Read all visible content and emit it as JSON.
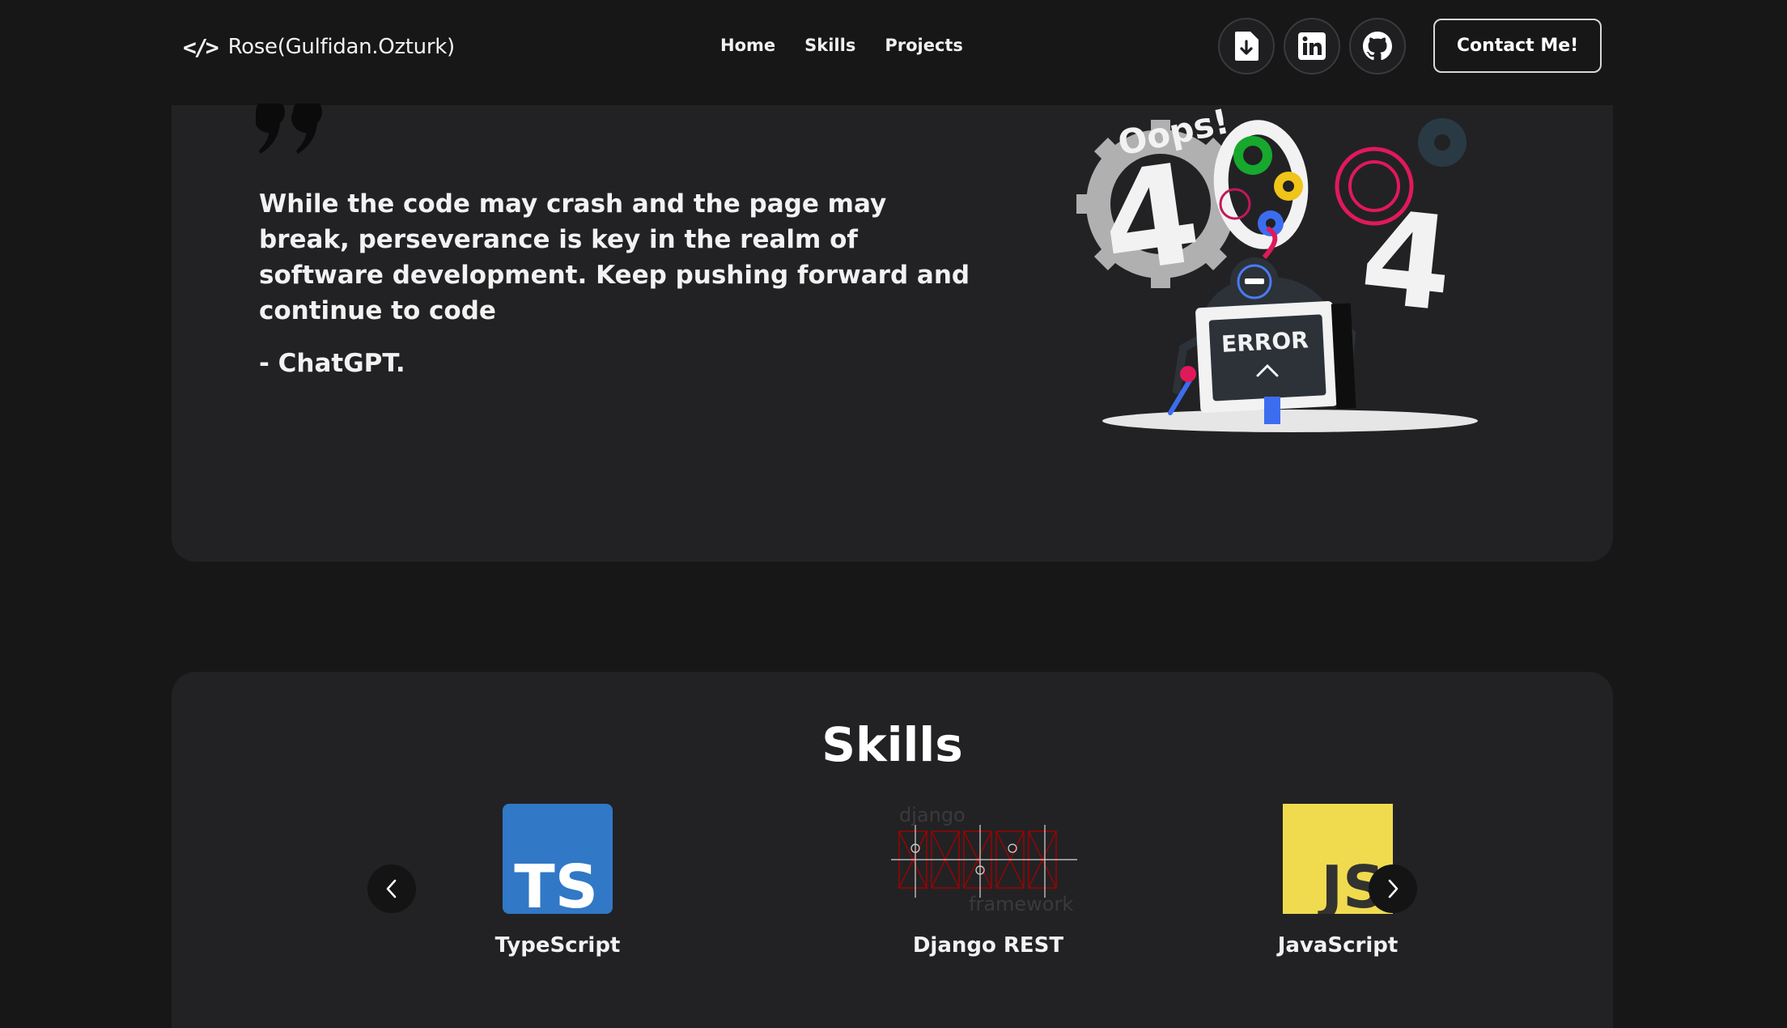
{
  "navbar": {
    "brand": "Rose(Gulfidan.Ozturk)",
    "brand_icon": "code-brackets-icon",
    "links": [
      "Home",
      "Skills",
      "Projects"
    ],
    "social_icons": [
      "download-resume-icon",
      "linkedin-icon",
      "github-icon"
    ],
    "contact_label": "Contact Me!"
  },
  "quote": {
    "text": "While the code may crash and the page may break, perseverance is key in the realm of software development. Keep pushing forward and continue to code",
    "author": "- ChatGPT.",
    "illustration": {
      "oops": "Oops!",
      "digits": [
        "4",
        "0",
        "4"
      ],
      "screen_label": "ERROR"
    }
  },
  "skills": {
    "title": "Skills",
    "items": [
      {
        "label": "TypeScript",
        "logo_text": "TS",
        "color": "#3178c6"
      },
      {
        "label": "Django REST",
        "logo_text_top": "django",
        "logo_text_bottom": "framework",
        "color": "#a30000"
      },
      {
        "label": "JavaScript",
        "logo_text": "JS",
        "color": "#f0db4f"
      }
    ]
  },
  "colors": {
    "background": "#171718",
    "card": "#222224",
    "accent_blue": "#3c6df0",
    "accent_pink": "#e0195a"
  }
}
